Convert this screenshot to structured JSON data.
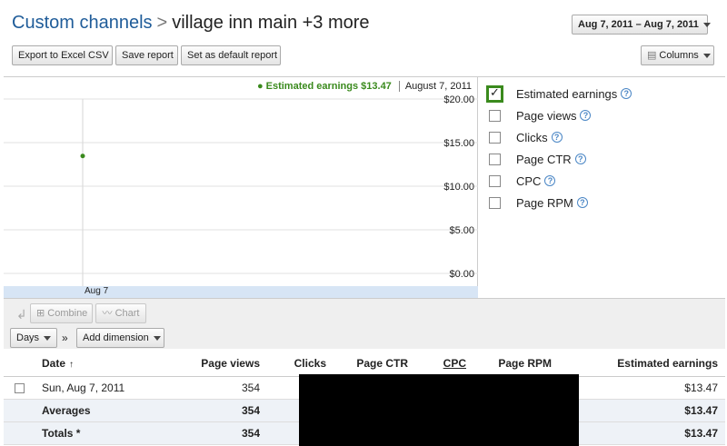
{
  "header": {
    "breadcrumb": "Custom channels",
    "separator": ">",
    "current": "village inn main +3 more",
    "date_range": "Aug 7, 2011 – Aug 7, 2011",
    "columns_label": "Columns"
  },
  "actions": {
    "export": "Export to Excel CSV",
    "save": "Save report",
    "set_default": "Set as default report"
  },
  "chart": {
    "legend_series": "Estimated earnings $13.47",
    "legend_date": "August 7, 2011",
    "tick_labels": [
      "$20.00",
      "$15.00",
      "$10.00",
      "$5.00",
      "$0.00"
    ],
    "x_label": "Aug 7",
    "series_color": "#3a8a1d"
  },
  "chart_data": {
    "type": "line",
    "x": [
      "Aug 7"
    ],
    "series": [
      {
        "name": "Estimated earnings",
        "values": [
          13.47
        ]
      }
    ],
    "ylim": [
      0,
      20
    ],
    "yticks": [
      0,
      5,
      10,
      15,
      20
    ],
    "grid": true
  },
  "metrics": [
    {
      "label": "Estimated earnings",
      "checked": true
    },
    {
      "label": "Page views",
      "checked": false
    },
    {
      "label": "Clicks",
      "checked": false
    },
    {
      "label": "Page CTR",
      "checked": false
    },
    {
      "label": "CPC",
      "checked": false
    },
    {
      "label": "Page RPM",
      "checked": false
    }
  ],
  "toolbar": {
    "combine": "Combine",
    "chart": "Chart",
    "days": "Days",
    "chevron": "»",
    "add_dimension": "Add dimension"
  },
  "table": {
    "headers": {
      "date": "Date",
      "sort": "↑",
      "page_views": "Page views",
      "clicks": "Clicks",
      "page_ctr": "Page CTR",
      "cpc": "CPC",
      "page_rpm": "Page RPM",
      "earnings": "Estimated earnings"
    },
    "row": {
      "date": "Sun, Aug 7, 2011",
      "page_views": "354",
      "earnings": "$13.47"
    },
    "averages": {
      "label": "Averages",
      "page_views": "354",
      "earnings": "$13.47"
    },
    "totals": {
      "label": "Totals *",
      "page_views": "354",
      "earnings": "$13.47"
    }
  }
}
